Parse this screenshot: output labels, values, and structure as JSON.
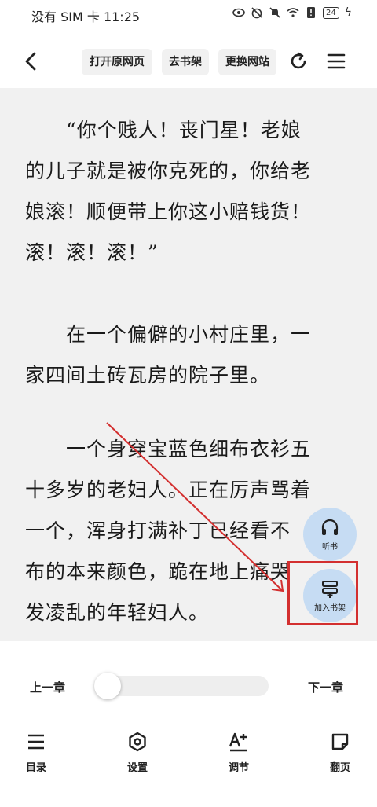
{
  "status_bar": {
    "carrier_time": "没有 SIM 卡 11:25",
    "battery": "24"
  },
  "nav": {
    "open_original": "打开原网页",
    "go_bookshelf": "去书架",
    "change_site": "更换网站"
  },
  "content": {
    "paragraphs": [
      [
        "“你个贱人！丧门星！老娘",
        "的儿子就是被你克死的，你给老",
        "娘滚！顺便带上你这小赔钱货！",
        "滚！滚！滚！”"
      ],
      [
        "在一个偏僻的小村庄里，一",
        "家四间土砖瓦房的院子里。"
      ],
      [
        "一个身穿宝蓝色细布衣衫五",
        "十多岁的老妇人。正在厉声骂着",
        "一个，浑身打满补丁已经看不",
        "布的本来颜色，跪在地上痛哭",
        "发凌乱的年轻妇人。"
      ]
    ]
  },
  "fabs": {
    "listen": "听书",
    "add_shelf": "加入书架"
  },
  "chapter": {
    "prev": "上一章",
    "next": "下一章",
    "progress": 0.0
  },
  "toolbar": {
    "toc": "目录",
    "settings": "设置",
    "adjust": "调节",
    "page_turn": "翻页"
  },
  "colors": {
    "reader_bg": "#f1f1f1",
    "fab_bg": "#c6dcf3",
    "highlight": "#d32f2f"
  }
}
